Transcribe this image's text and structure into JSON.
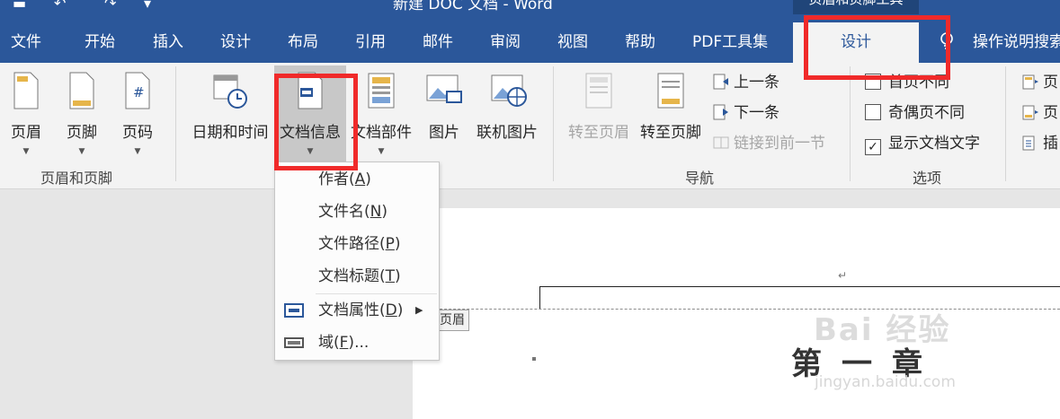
{
  "title_bar": {
    "doc_title": "新建 DOC 文档 - Word",
    "context_tools_label": "页眉和页脚工具"
  },
  "tabs": [
    "文件",
    "开始",
    "插入",
    "设计",
    "布局",
    "引用",
    "邮件",
    "审阅",
    "视图",
    "帮助",
    "PDF工具集"
  ],
  "active_tab": "设计",
  "search": "操作说明搜索",
  "ribbon": {
    "header_footer": {
      "group_label": "页眉和页脚",
      "buttons": [
        "页眉",
        "页脚",
        "页码"
      ]
    },
    "insert": {
      "buttons": [
        "日期和时间",
        "文档信息",
        "文档部件",
        "图片",
        "联机图片"
      ]
    },
    "navigation": {
      "group_label": "导航",
      "goto_header": "转至页眉",
      "goto_footer": "转至页脚",
      "previous": "上一条",
      "next": "下一条",
      "link_previous": "链接到前一节"
    },
    "options": {
      "group_label": "选项",
      "first_page_diff": {
        "label": "首页不同",
        "checked": false
      },
      "odd_even_diff": {
        "label": "奇偶页不同",
        "checked": false
      },
      "show_doc_text": {
        "label": "显示文档文字",
        "checked": true
      }
    },
    "position": {
      "items": [
        "页",
        "页",
        "插"
      ]
    }
  },
  "dropdown": {
    "items": [
      {
        "label": "作者",
        "key": "A"
      },
      {
        "label": "文件名",
        "key": "N"
      },
      {
        "label": "文件路径",
        "key": "P"
      },
      {
        "label": "文档标题",
        "key": "T"
      },
      {
        "label": "文档属性",
        "key": "D",
        "submenu": true
      },
      {
        "label": "域",
        "key": "F",
        "suffix": "..."
      }
    ]
  },
  "document": {
    "header_tag": "页眉",
    "chapter_text": "第一章",
    "watermark": "Bai 经验",
    "watermark_url": "jingyan.baidu.com"
  },
  "colors": {
    "brand": "#2b579a",
    "highlight_box": "#f02a2a"
  }
}
